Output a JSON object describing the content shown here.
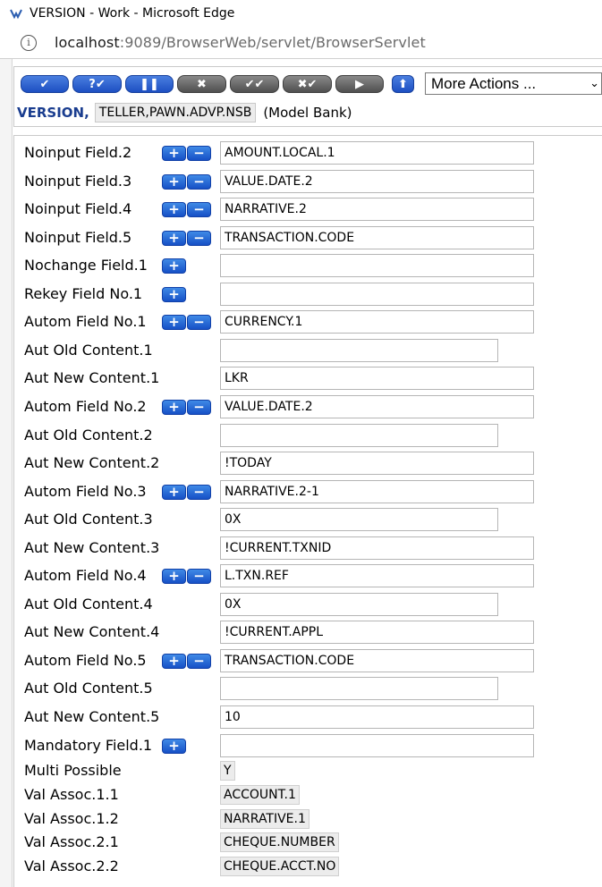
{
  "browser": {
    "window_title": "VERSION - Work - Microsoft Edge",
    "url_host": "localhost",
    "url_rest": ":9089/BrowserWeb/servlet/BrowserServlet"
  },
  "toolbar": {
    "buttons": [
      {
        "icon": "check-icon",
        "glyph": "✔",
        "style": "blue"
      },
      {
        "icon": "validate-icon",
        "glyph": "?✔",
        "style": "blue"
      },
      {
        "icon": "hold-icon",
        "glyph": "❚❚",
        "style": "blue"
      },
      {
        "icon": "delete-icon",
        "glyph": "✖",
        "style": "grey"
      },
      {
        "icon": "authorise-icon",
        "glyph": "✔✔",
        "style": "grey"
      },
      {
        "icon": "reverse-icon",
        "glyph": "✖✔",
        "style": "grey"
      },
      {
        "icon": "next-icon",
        "glyph": "▶",
        "style": "grey"
      },
      {
        "icon": "up-arrow-icon",
        "glyph": "⬆",
        "style": "blue"
      }
    ],
    "more_actions": "More Actions ..."
  },
  "version": {
    "label": "VERSION,",
    "name": "TELLER,PAWN.ADVP.NSB",
    "company": "(Model Bank)"
  },
  "rows": [
    {
      "label": "Noinput Field.2",
      "plus": true,
      "minus": true,
      "value": "AMOUNT.LOCAL.1"
    },
    {
      "label": "Noinput Field.3",
      "plus": true,
      "minus": true,
      "value": "VALUE.DATE.2"
    },
    {
      "label": "Noinput Field.4",
      "plus": true,
      "minus": true,
      "value": "NARRATIVE.2"
    },
    {
      "label": "Noinput Field.5",
      "plus": true,
      "minus": true,
      "value": "TRANSACTION.CODE"
    },
    {
      "label": "Nochange Field.1",
      "plus": true,
      "minus": false,
      "value": ""
    },
    {
      "label": "Rekey Field No.1",
      "plus": true,
      "minus": false,
      "value": ""
    },
    {
      "label": "Autom Field No.1",
      "plus": true,
      "minus": true,
      "value": "CURRENCY.1"
    },
    {
      "label": "Aut Old Content.1",
      "plus": false,
      "minus": false,
      "value": "",
      "short": true
    },
    {
      "label": "Aut New Content.1",
      "plus": false,
      "minus": false,
      "value": "LKR"
    },
    {
      "label": "Autom Field No.2",
      "plus": true,
      "minus": true,
      "value": "VALUE.DATE.2"
    },
    {
      "label": "Aut Old Content.2",
      "plus": false,
      "minus": false,
      "value": "",
      "short": true
    },
    {
      "label": "Aut New Content.2",
      "plus": false,
      "minus": false,
      "value": "!TODAY"
    },
    {
      "label": "Autom Field No.3",
      "plus": true,
      "minus": true,
      "value": "NARRATIVE.2-1"
    },
    {
      "label": "Aut Old Content.3",
      "plus": false,
      "minus": false,
      "value": "0X",
      "short": true
    },
    {
      "label": "Aut New Content.3",
      "plus": false,
      "minus": false,
      "value": "!CURRENT.TXNID"
    },
    {
      "label": "Autom Field No.4",
      "plus": true,
      "minus": true,
      "value": "L.TXN.REF"
    },
    {
      "label": "Aut Old Content.4",
      "plus": false,
      "minus": false,
      "value": "0X",
      "short": true
    },
    {
      "label": "Aut New Content.4",
      "plus": false,
      "minus": false,
      "value": "!CURRENT.APPL"
    },
    {
      "label": "Autom Field No.5",
      "plus": true,
      "minus": true,
      "value": "TRANSACTION.CODE"
    },
    {
      "label": "Aut Old Content.5",
      "plus": false,
      "minus": false,
      "value": "",
      "short": true
    },
    {
      "label": "Aut New Content.5",
      "plus": false,
      "minus": false,
      "value": "10"
    },
    {
      "label": "Mandatory Field.1",
      "plus": true,
      "minus": false,
      "value": ""
    }
  ],
  "readonly_rows": [
    {
      "label": "Multi Possible",
      "value": "Y"
    },
    {
      "label": "Val Assoc.1.1",
      "value": "ACCOUNT.1"
    },
    {
      "label": "Val Assoc.1.2",
      "value": "NARRATIVE.1"
    },
    {
      "label": "Val Assoc.2.1",
      "value": "CHEQUE.NUMBER"
    },
    {
      "label": "Val Assoc.2.2",
      "value": "CHEQUE.ACCT.NO"
    }
  ]
}
